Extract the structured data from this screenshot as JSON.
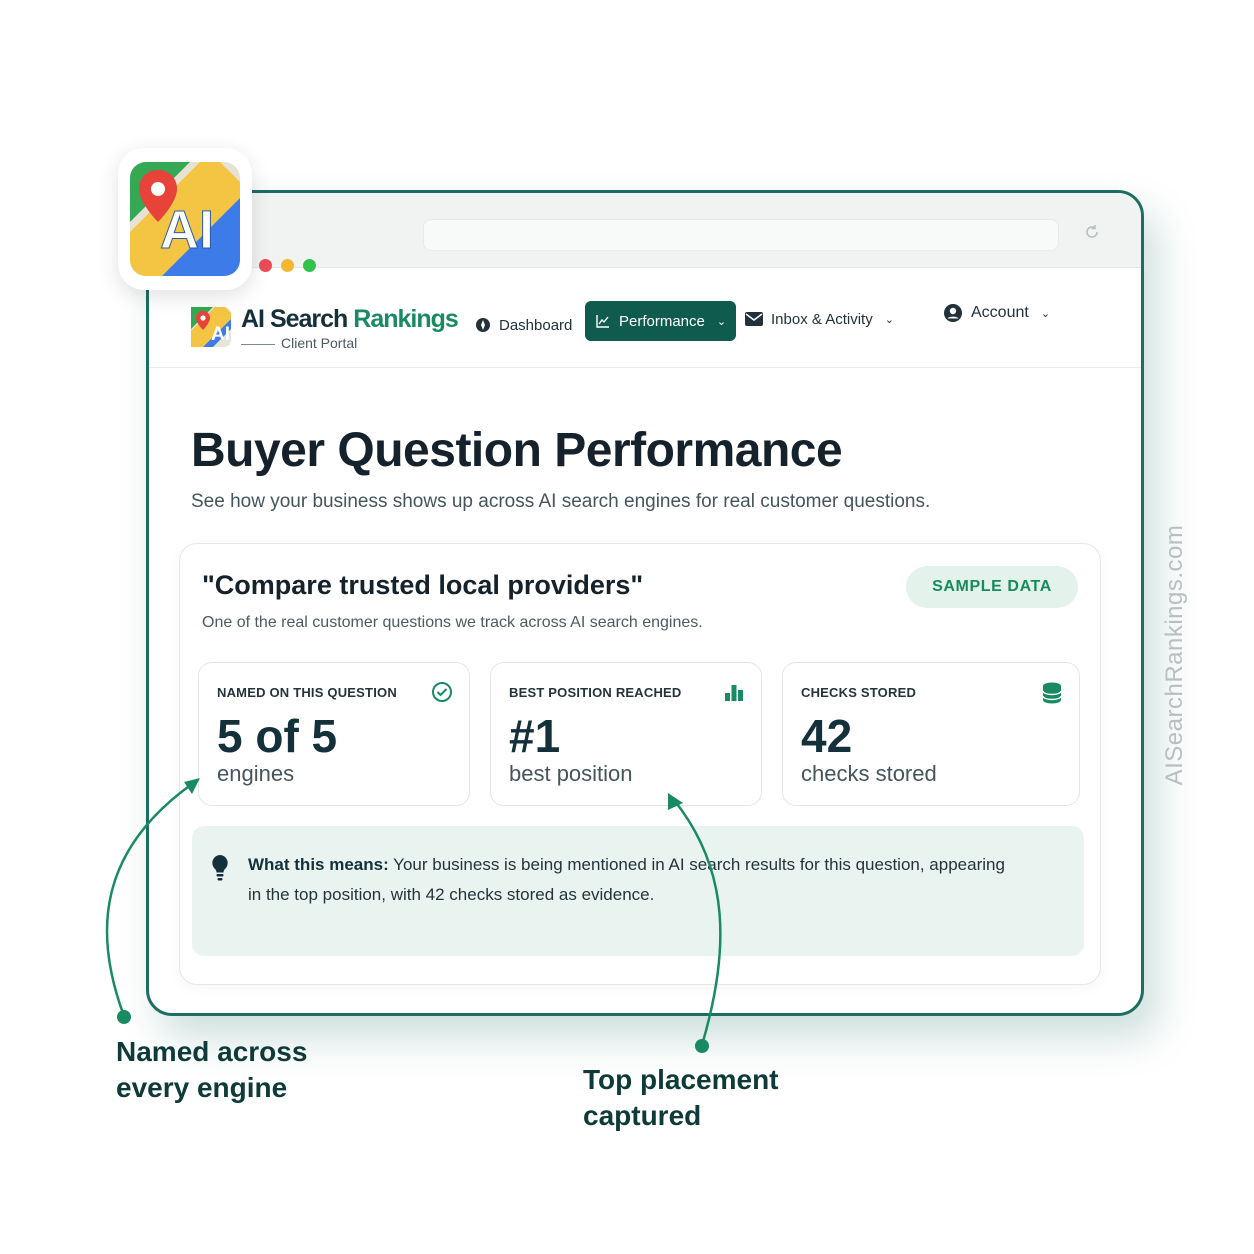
{
  "app_icon": {
    "text": "AI",
    "icon": "map-pin-ai-logo"
  },
  "brand": {
    "name_part1": "AI Search",
    "name_part2": "Rankings",
    "subtitle": "Client Portal",
    "logo_text": "AI"
  },
  "nav": {
    "items": [
      {
        "label": "Dashboard",
        "icon": "compass-icon",
        "active": false
      },
      {
        "label": "Performance",
        "icon": "trend-chart-icon",
        "active": true,
        "has_dropdown": true
      },
      {
        "label": "Inbox & Activity",
        "icon": "envelope-icon",
        "active": false,
        "has_dropdown": true
      }
    ],
    "account": {
      "label": "Account",
      "icon": "user-circle-icon",
      "has_dropdown": true
    }
  },
  "page": {
    "title": "Buyer Question Performance",
    "subtitle": "See how your business shows up across AI search engines for real customer questions."
  },
  "question_card": {
    "title": "\"Compare trusted local providers\"",
    "subtitle": "One of the real customer questions we track across AI search engines.",
    "badge": "SAMPLE DATA",
    "stats": [
      {
        "label": "NAMED ON THIS QUESTION",
        "value": "5 of 5",
        "unit": "engines",
        "icon": "check-circle-icon"
      },
      {
        "label": "BEST POSITION REACHED",
        "value": "#1",
        "unit": "best position",
        "icon": "bar-chart-icon"
      },
      {
        "label": "CHECKS STORED",
        "value": "42",
        "unit": "checks stored",
        "icon": "database-icon"
      }
    ],
    "meaning": {
      "label": "What this means:",
      "text": "Your business is being mentioned in AI search results for this question, appearing in the top position, with 42 checks stored as evidence."
    }
  },
  "callouts": {
    "left_line1": "Named across",
    "left_line2": "every engine",
    "right_line1": "Top placement",
    "right_line2": "captured"
  },
  "watermark": "AISearchRankings.com",
  "colors": {
    "accent": "#0f5c4f",
    "brand_green": "#1a8a62",
    "frame": "#1c6e62",
    "badge_bg": "#e3f3ec",
    "meaning_bg": "#e9f4f0"
  }
}
